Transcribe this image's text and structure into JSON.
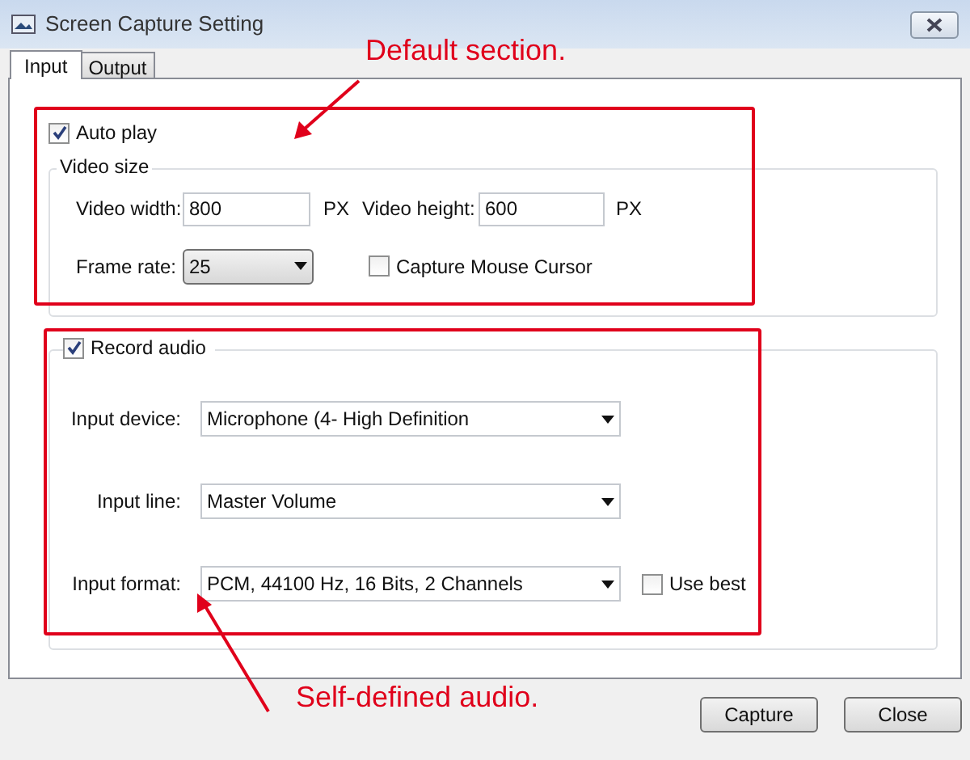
{
  "window": {
    "title": "Screen Capture Setting"
  },
  "tabs": [
    {
      "label": "Input",
      "selected": true
    },
    {
      "label": "Output",
      "selected": false
    }
  ],
  "auto_play": {
    "label": "Auto play",
    "checked": true
  },
  "video_size": {
    "title": "Video size",
    "width_label": "Video width:",
    "width_value": "800",
    "width_unit": "PX",
    "height_label": "Video height:",
    "height_value": "600",
    "height_unit": "PX",
    "frame_rate_label": "Frame rate:",
    "frame_rate_value": "25",
    "capture_cursor": {
      "label": "Capture Mouse Cursor",
      "checked": false
    }
  },
  "record_audio": {
    "label": "Record audio",
    "checked": true
  },
  "audio_fields": [
    {
      "label": "Input device:",
      "value": "Microphone (4- High Definition"
    },
    {
      "label": "Input line:",
      "value": "Master Volume"
    },
    {
      "label": "Input format:",
      "value": "PCM, 44100 Hz, 16 Bits, 2 Channels"
    }
  ],
  "use_best": {
    "label": "Use best",
    "checked": false
  },
  "buttons": [
    "Capture",
    "Close"
  ],
  "annotations": [
    {
      "text": "Default section."
    },
    {
      "text": "Self-defined audio."
    }
  ]
}
